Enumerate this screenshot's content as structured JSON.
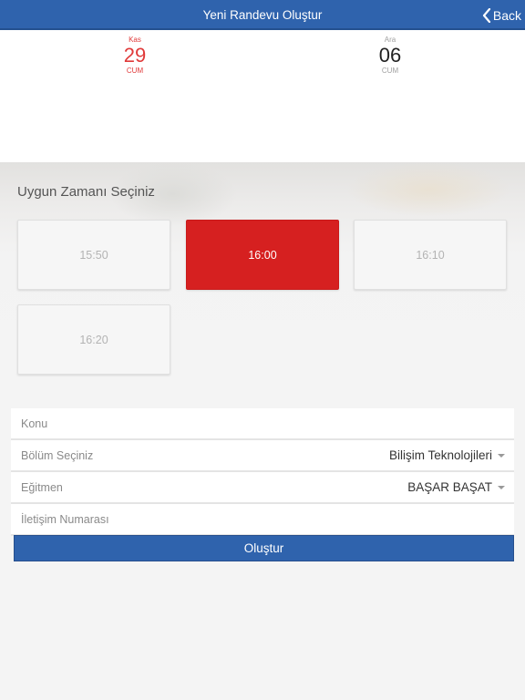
{
  "header": {
    "title": "Yeni Randevu Oluştur",
    "back_label": "Back"
  },
  "dates": [
    {
      "month": "Kas",
      "day": "29",
      "weekday": "CUM",
      "selected": true,
      "color": "#e03a3a"
    },
    {
      "month": "Ara",
      "day": "06",
      "weekday": "CUM",
      "selected": false
    }
  ],
  "time_section": {
    "title": "Uygun Zamanı Seçiniz",
    "slots": [
      {
        "label": "15:50",
        "selected": false
      },
      {
        "label": "16:00",
        "selected": true
      },
      {
        "label": "16:10",
        "selected": false
      },
      {
        "label": "16:20",
        "selected": false
      }
    ]
  },
  "form": {
    "subject_placeholder": "Konu",
    "department_label": "Bölüm Seçiniz",
    "department_value": "Bilişim Teknolojileri",
    "instructor_label": "Eğitmen",
    "instructor_value": "BAŞAR BAŞAT",
    "phone_placeholder": "İletişim Numarası",
    "submit_label": "Oluştur"
  },
  "colors": {
    "primary": "#2f63ad",
    "selected_slot": "#d62020",
    "accent_date": "#e03a3a"
  },
  "icons": {
    "back": "chevron-left-icon",
    "dropdown": "caret-down-icon"
  }
}
